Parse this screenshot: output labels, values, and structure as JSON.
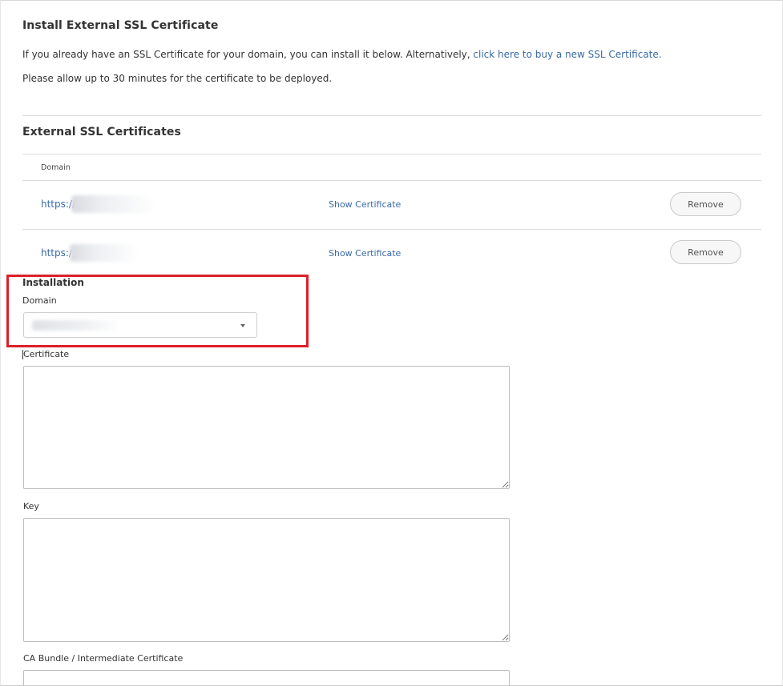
{
  "install_section": {
    "title": "Install External SSL Certificate",
    "intro_prefix": "If you already have an SSL Certificate for your domain, you can install it below. Alternatively, ",
    "intro_link": "click here to buy a new SSL Certificate.",
    "deploy_note": "Please allow up to 30 minutes for the certificate to be deployed."
  },
  "certificates_section": {
    "title": "External SSL Certificates",
    "column_header": "Domain",
    "rows": [
      {
        "domain_prefix": "https://",
        "show_label": "Show Certificate",
        "remove_label": "Remove"
      },
      {
        "domain_prefix": "https://",
        "show_label": "Show Certificate",
        "remove_label": "Remove"
      }
    ]
  },
  "installation": {
    "title": "Installation",
    "domain_label": "Domain",
    "certificate_label": "Certificate",
    "key_label": "Key",
    "ca_bundle_label": "CA Bundle / Intermediate Certificate"
  },
  "colors": {
    "link": "#3a6aa6",
    "highlight_border": "#dc1f2a"
  }
}
